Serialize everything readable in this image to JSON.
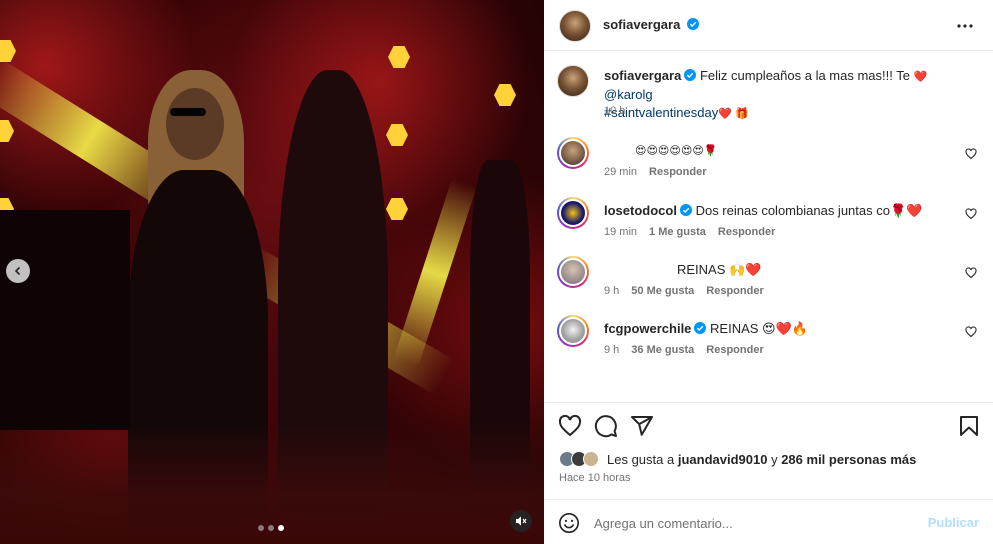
{
  "post": {
    "author": "sofiavergara",
    "verified": true
  },
  "caption": {
    "author": "sofiavergara",
    "text": "Feliz cumpleaños a la mas mas!!! Te",
    "heart": "❤️",
    "mention": "@karolg",
    "hashtag": "#saintvalentinesday",
    "trailing": "❤️ 🎁",
    "time": "10 h"
  },
  "comments": [
    {
      "username": "",
      "text": "😍😍😍😍😍😍🌹",
      "time": "29 min",
      "likes": "",
      "reply": "Responder",
      "verified": false
    },
    {
      "username": "losetodocol",
      "text": "Dos reinas colombianas juntas co🌹❤️",
      "time": "19 min",
      "likes": "1 Me gusta",
      "reply": "Responder",
      "verified": true
    },
    {
      "username": "",
      "text": "REINAS 🙌❤️",
      "time": "9 h",
      "likes": "50 Me gusta",
      "reply": "Responder",
      "verified": false
    },
    {
      "username": "fcgpowerchile",
      "text": "REINAS 😍❤️🔥",
      "time": "9 h",
      "likes": "36 Me gusta",
      "reply": "Responder",
      "verified": true
    }
  ],
  "likes": {
    "prefix": "Les gusta a",
    "user": "juandavid9010",
    "middle": "y",
    "count": "286 mil personas más"
  },
  "posted": "Hace 10 horas",
  "composer": {
    "placeholder": "Agrega un comentario...",
    "publish": "Publicar"
  },
  "carousel": {
    "slides": 3,
    "active": 3
  },
  "colors": {
    "verified": "#0095f6",
    "link": "#00376b",
    "publish_disabled": "#b2dffc",
    "muted_text": "#737373"
  },
  "icons": [
    "more-options-icon",
    "heart-icon",
    "comment-icon",
    "share-icon",
    "save-icon",
    "emoji-icon",
    "speaker-muted-icon",
    "chevron-left-icon",
    "verified-icon"
  ]
}
